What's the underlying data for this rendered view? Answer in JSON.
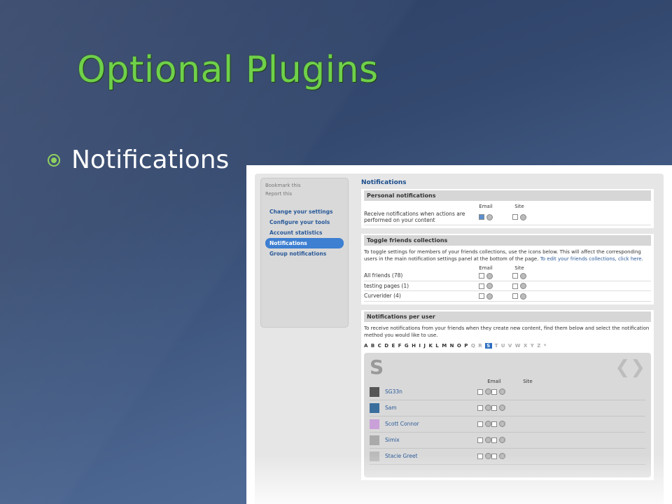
{
  "slide": {
    "title": "Optional Plugins",
    "bullet": "Notifications"
  },
  "sidebar": {
    "util": [
      "Bookmark this",
      "Report this"
    ],
    "items": [
      {
        "label": "Change your settings",
        "active": false
      },
      {
        "label": "Configure your tools",
        "active": false
      },
      {
        "label": "Account statistics",
        "active": false
      },
      {
        "label": "Notifications",
        "active": true
      },
      {
        "label": "Group notifications",
        "active": false
      }
    ]
  },
  "main": {
    "heading": "Notifications",
    "personal": {
      "header": "Personal notifications",
      "col_email": "Email",
      "col_site": "Site",
      "row_label": "Receive notifications when actions are performed on your content"
    },
    "toggle": {
      "header": "Toggle friends collections",
      "text": "To toggle settings for members of your friends collections, use the icons below. This will affect the corresponding users in the main notification settings panel at the bottom of the page.",
      "link": "To edit your friends collections, click here.",
      "col_email": "Email",
      "col_site": "Site",
      "rows": [
        "All friends (78)",
        "testing pages (1)",
        "Curverider (4)"
      ]
    },
    "per_user": {
      "header": "Notifications per user",
      "text": "To receive notifications from your friends when they create new content, find them below and select the notification method you would like to use.",
      "alphabet_before": "A B C D E F G H I J K L M N O P",
      "alphabet_dim": "Q R",
      "alphabet_active": "S",
      "alphabet_after": "T U V W X Y Z *",
      "letter": "S",
      "col_email": "Email",
      "col_site": "Site",
      "users": [
        "SG33n",
        "Sam",
        "Scott Connor",
        "Simix",
        "Stacie Greet"
      ]
    }
  },
  "colors": {
    "title": "#6fd14a",
    "bullet": "#8fd05e",
    "link": "#2a5a99",
    "active": "#3d7fd1"
  }
}
